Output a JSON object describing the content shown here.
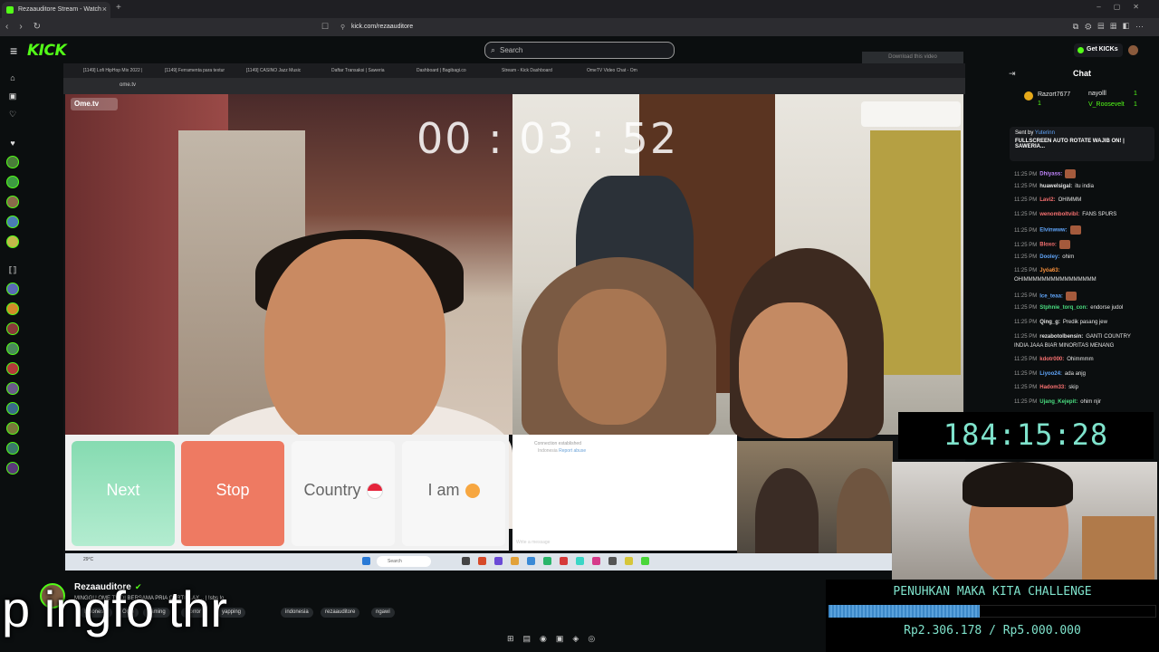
{
  "browser": {
    "tab_title": "Rezaauditore Stream - Watch",
    "new_tab": "+",
    "url": "kick.com/rezaauditore"
  },
  "kick": {
    "logo": "KICK",
    "search_placeholder": "Search",
    "get_kicks": "Get KICKs",
    "download_video": "Download this video"
  },
  "stream_browser": {
    "tabs": [
      "[1149] Lofi HipHop Mix 2022 |",
      "[1149] Ferramenta para textur",
      "[1149] CASINO Jazz Music",
      "Daftar Transaksi | Saweria",
      "Dashboard | Bagibagi.co",
      "Stream - Kick Dashboard",
      "OmeTV Video Chat - Om"
    ],
    "url": "ome.tv",
    "logo": "Ome.tv"
  },
  "video": {
    "timer": "00 : 03 : 52",
    "buttons": {
      "next": "Next",
      "stop": "Stop",
      "country": "Country",
      "iam": "I am"
    },
    "connection_status": "Connection established",
    "connection_country": "Indonesia",
    "report_link": "Report abuse",
    "message_placeholder": "Write a message",
    "windows_search": "Search",
    "weather": "29°C"
  },
  "chat": {
    "title": "Chat",
    "gifters": [
      {
        "name": "Razort7677",
        "count": "1"
      },
      {
        "name": "nayolll",
        "count": "1"
      },
      {
        "name": "V_Roosevelt",
        "count": "1"
      }
    ],
    "pinned": {
      "sent_by_label": "Sent by",
      "sender": "Yuterinn",
      "text": "FULLSCREEN AUTO ROTATE WAJIB ON! | SAWERIA..."
    },
    "messages": [
      {
        "time": "11:25 PM",
        "user": "Dhiyass",
        "text": "",
        "color": "#c084fc",
        "emote": true
      },
      {
        "time": "11:25 PM",
        "user": "huawelsigal",
        "text": "itu india",
        "color": "#e6e6e6",
        "emote": false
      },
      {
        "time": "11:25 PM",
        "user": "Lavi2",
        "text": "OHIMMM",
        "color": "#f87171",
        "emote": false
      },
      {
        "time": "11:25 PM",
        "user": "wenomboltvibl",
        "text": "FANS SPURS",
        "color": "#f87171",
        "emote": false
      },
      {
        "time": "11:25 PM",
        "user": "Elvinwww",
        "text": "",
        "color": "#60a5fa",
        "emote": true
      },
      {
        "time": "11:25 PM",
        "user": "Bloxo",
        "text": "",
        "color": "#f87171",
        "emote": true
      },
      {
        "time": "11:25 PM",
        "user": "Dooley",
        "text": "ohim",
        "color": "#60a5fa",
        "emote": false
      },
      {
        "time": "11:25 PM",
        "user": "Jyóa63",
        "text": "",
        "color": "#fb923c",
        "emote": false
      },
      {
        "time": "",
        "user": "",
        "text": "OHIMMMMMMMMMMMMMMMM",
        "color": "#e6e6e6",
        "emote": false
      },
      {
        "time": "11:25 PM",
        "user": "Ice_teaa",
        "text": "",
        "color": "#60a5fa",
        "emote": true
      },
      {
        "time": "11:25 PM",
        "user": "Stphnie_torq_con",
        "text": "endorse judol",
        "color": "#4ade80",
        "emote": false
      },
      {
        "time": "11:25 PM",
        "user": "Qing_g",
        "text": "Predik pasang jew",
        "color": "#e6e6e6",
        "emote": false
      },
      {
        "time": "11:25 PM",
        "user": "rezabotolbensin",
        "text": "GANTI COUNTRY",
        "color": "#e6e6e6",
        "emote": false
      },
      {
        "time": "",
        "user": "",
        "text": "INDIA JAAA BIAR MINORITAS MENANG",
        "color": "#e6e6e6",
        "emote": false
      },
      {
        "time": "11:25 PM",
        "user": "kdotr000",
        "text": "Ohimmmm",
        "color": "#f87171",
        "emote": false
      },
      {
        "time": "11:25 PM",
        "user": "Liyoo24",
        "text": "ada anjg",
        "color": "#60a5fa",
        "emote": false
      },
      {
        "time": "11:25 PM",
        "user": "Hadom33",
        "text": "skip",
        "color": "#f87171",
        "emote": false
      },
      {
        "time": "11:25 PM",
        "user": "Ujang_Kejepit",
        "text": "ohim njir",
        "color": "#4ade80",
        "emote": false
      }
    ]
  },
  "overlay": {
    "clock": "184:15:28",
    "challenge_title": "PENUHKAN MAKA KITA CHALLENGE",
    "challenge_amount": "Rp2.306.178 / Rp5.000.000",
    "progress_fraction": 0.4612,
    "caption": "p ingfo thr"
  },
  "channel": {
    "name": "Rezaauditore",
    "stream_title": "MINGGU OME TV DI BERSAMA PRIA CURTISLAX... | !sbs lo",
    "tags": [
      "Indonesia",
      "Ome",
      "gaming",
      "Horror",
      "yapping",
      "indonesia",
      "rezaauditore",
      "ngawi"
    ]
  },
  "colors": {
    "kick_green": "#53fc18",
    "overlay_teal": "#7fe3cc",
    "next_green": "#86dbb1",
    "stop_red": "#ee7a62"
  }
}
